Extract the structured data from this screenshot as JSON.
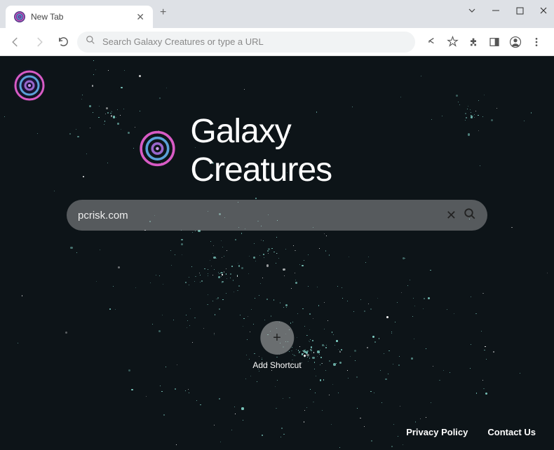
{
  "window": {
    "tab_title": "New Tab"
  },
  "toolbar": {
    "omnibox_placeholder": "Search Galaxy Creatures or type a URL"
  },
  "page": {
    "title": "Galaxy Creatures",
    "search_value": "pcrisk.com",
    "shortcut_label": "Add Shortcut"
  },
  "footer": {
    "privacy": "Privacy Policy",
    "contact": "Contact Us"
  },
  "icons": {
    "spiral": "spiral-icon",
    "search": "search-icon",
    "close": "close-icon"
  }
}
